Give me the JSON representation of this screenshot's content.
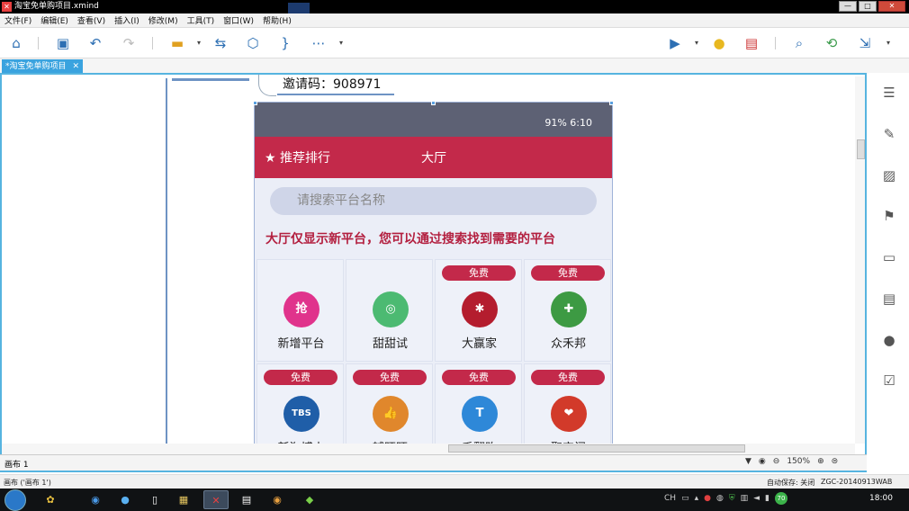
{
  "window": {
    "app_icon": "xmind-icon",
    "title": "淘宝免单购项目.xmind",
    "buttons": [
      "—",
      "□",
      "✕"
    ]
  },
  "menu": [
    "文件(F)",
    "编辑(E)",
    "查看(V)",
    "插入(I)",
    "修改(M)",
    "工具(T)",
    "窗口(W)",
    "帮助(H)"
  ],
  "doc_tab": {
    "label": "*淘宝免单购项目",
    "close": "✕"
  },
  "topic": {
    "text": "邀请码：908971"
  },
  "phone": {
    "status": "91%   6:10",
    "header_rank": "★ 推荐排行",
    "header_hall": "大厅",
    "search_placeholder": "请搜索平台名称",
    "notice": "大厅仅显示新平台，您可以通过搜索找到需要的平台",
    "apps": [
      {
        "badge": "",
        "label": "新增平台",
        "icon": "抢",
        "color": "#e0338c"
      },
      {
        "badge": "",
        "label": "甜甜试",
        "icon": "◎",
        "color": "#4cba72"
      },
      {
        "badge": "免费",
        "label": "大赢家",
        "icon": "✱",
        "color": "#b41d2e"
      },
      {
        "badge": "免费",
        "label": "众禾邦",
        "icon": "✚",
        "color": "#3d9a43"
      },
      {
        "badge": "免费",
        "label": "新淘博士",
        "icon": "TBS",
        "color": "#1f5ea8"
      },
      {
        "badge": "免费",
        "label": "辅旺旺",
        "icon": "👍",
        "color": "#e0872c"
      },
      {
        "badge": "免费",
        "label": "千翻购",
        "icon": "T",
        "color": "#2e88d8"
      },
      {
        "badge": "免费",
        "label": "聚宝阁",
        "icon": "❤",
        "color": "#d23a2a"
      }
    ]
  },
  "sheet": {
    "tab": "画布 1",
    "zoom": "150%"
  },
  "status": {
    "left": "画布 ('画布 1')",
    "autosave": "自动保存: 关闭",
    "machine": "ZGC-20140913WAB"
  },
  "taskbar": {
    "ime": "CH",
    "clock": "18:00",
    "badge": "70"
  }
}
